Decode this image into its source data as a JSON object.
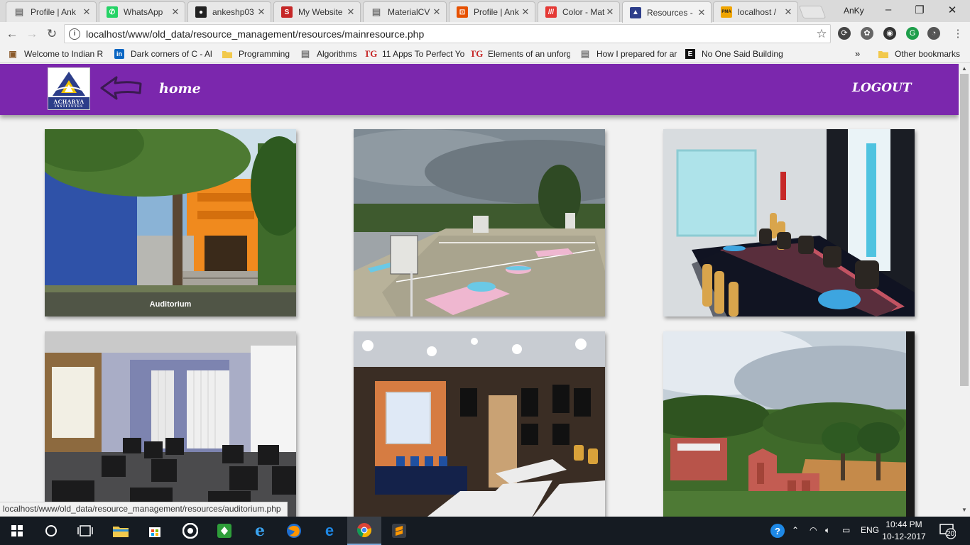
{
  "browser": {
    "tabs": [
      {
        "title": "Profile | Ank",
        "icon": "doc-icon",
        "color": "#777777"
      },
      {
        "title": "WhatsApp",
        "icon": "whatsapp-icon",
        "color": "#25d366"
      },
      {
        "title": "ankeshp03",
        "icon": "github-icon",
        "color": "#222222"
      },
      {
        "title": "My Website",
        "icon": "s-icon",
        "color": "#c62828"
      },
      {
        "title": "MaterialCV",
        "icon": "doc-icon",
        "color": "#777777"
      },
      {
        "title": "Profile | Ank",
        "icon": "html5-icon",
        "color": "#e65100"
      },
      {
        "title": "Color - Mat",
        "icon": "mat-icon",
        "color": "#e53935"
      },
      {
        "title": "Resources -",
        "icon": "acharya-icon",
        "color": "#2d3e8a",
        "active": true
      },
      {
        "title": "localhost /",
        "icon": "pma-icon",
        "color": "#f0a500"
      }
    ],
    "profile_name": "AnKy",
    "url": "localhost/www/old_data/resource_management/resources/mainresource.php",
    "bookmarks": [
      {
        "label": "Welcome to Indian R",
        "icon": "ir-icon"
      },
      {
        "label": "Dark corners of C - Al",
        "icon": "linkedin-icon"
      },
      {
        "label": "Programming",
        "icon": "folder-icon"
      },
      {
        "label": "Algorithms",
        "icon": "doc-icon"
      },
      {
        "label": "11 Apps To Perfect Yo",
        "icon": "tg-icon"
      },
      {
        "label": "Elements of an unforg",
        "icon": "tg-icon"
      },
      {
        "label": "How I prepared for ar",
        "icon": "doc-icon"
      },
      {
        "label": "No One Said Building",
        "icon": "e-icon"
      }
    ],
    "bookmarks_overflow": "»",
    "other_bookmarks": "Other bookmarks",
    "status_url": "localhost/www/old_data/resource_management/resources/auditorium.php"
  },
  "header": {
    "logo_text": "ACHARYA",
    "logo_subtext": "INSTITUTES",
    "home_label": "home",
    "logout_label": "LOGOUT",
    "bg_color": "#7b27ad"
  },
  "resources": [
    {
      "caption": "Auditorium",
      "scene": "building"
    },
    {
      "caption": "",
      "scene": "court"
    },
    {
      "caption": "",
      "scene": "boardroom"
    },
    {
      "caption": "",
      "scene": "computer-lab"
    },
    {
      "caption": "",
      "scene": "seminar-hall"
    },
    {
      "caption": "",
      "scene": "campus-view"
    }
  ],
  "taskbar": {
    "language": "ENG",
    "time": "10:44 PM",
    "date": "10-12-2017",
    "notification_count": "20"
  }
}
